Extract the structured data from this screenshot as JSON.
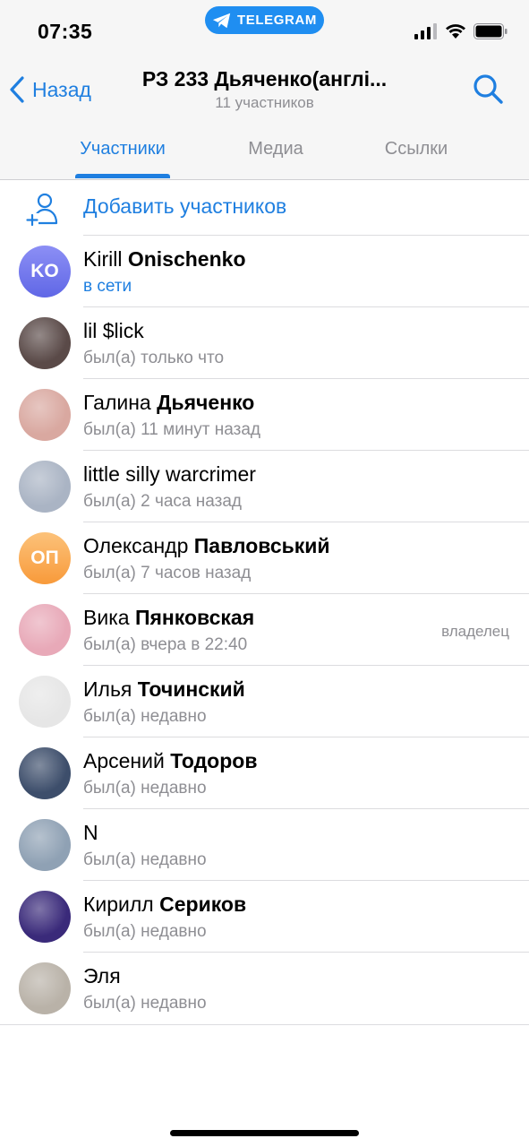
{
  "status_bar": {
    "time": "07:35",
    "app_pill": "TELEGRAM"
  },
  "header": {
    "back_label": "Назад",
    "title": "РЗ 233 Дьяченко(англі...",
    "subtitle": "11 участников"
  },
  "tabs": [
    {
      "label": "Участники",
      "active": true
    },
    {
      "label": "Медиа",
      "active": false
    },
    {
      "label": "Ссылки",
      "active": false
    }
  ],
  "add_members_label": "Добавить участников",
  "members": [
    {
      "first": "Kirill",
      "last": "Onischenko",
      "status": "в сети",
      "online": true,
      "initials": "KO",
      "avatar_color": "#7b7ff0",
      "role": ""
    },
    {
      "first": "lil $lick",
      "last": "",
      "status": "был(а) только что",
      "online": false,
      "initials": "",
      "avatar_color": "#5a4a48",
      "role": ""
    },
    {
      "first": "Галина",
      "last": "Дьяченко",
      "status": "был(а) 11 минут назад",
      "online": false,
      "initials": "",
      "avatar_color": "#d9a8a0",
      "role": ""
    },
    {
      "first": "little silly warcrimer",
      "last": "",
      "status": "был(а) 2 часа назад",
      "online": false,
      "initials": "",
      "avatar_color": "#aab4c4",
      "role": ""
    },
    {
      "first": "Олександр",
      "last": "Павловський",
      "status": "был(а) 7 часов назад",
      "online": false,
      "initials": "ОП",
      "avatar_color": "#fbab4e",
      "role": ""
    },
    {
      "first": "Вика",
      "last": "Пянковская",
      "status": "был(а) вчера в 22:40",
      "online": false,
      "initials": "",
      "avatar_color": "#e8a9b8",
      "role": "владелец"
    },
    {
      "first": "Илья",
      "last": "Точинский",
      "status": "был(а) недавно",
      "online": false,
      "initials": "",
      "avatar_color": "#e6e6e6",
      "role": ""
    },
    {
      "first": "Арсений",
      "last": "Тодоров",
      "status": "был(а) недавно",
      "online": false,
      "initials": "",
      "avatar_color": "#3d4e6b",
      "role": ""
    },
    {
      "first": "N",
      "last": "",
      "status": "был(а) недавно",
      "online": false,
      "initials": "",
      "avatar_color": "#8fa1b4",
      "role": ""
    },
    {
      "first": "Кирилл",
      "last": "Сериков",
      "status": "был(а) недавно",
      "online": false,
      "initials": "",
      "avatar_color": "#3a2a7a",
      "role": ""
    },
    {
      "first": "Эля",
      "last": "",
      "status": "был(а) недавно",
      "online": false,
      "initials": "",
      "avatar_color": "#b9b2a8",
      "role": ""
    }
  ],
  "colors": {
    "accent": "#1f7fe0",
    "secondary_text": "#8e8e93"
  }
}
